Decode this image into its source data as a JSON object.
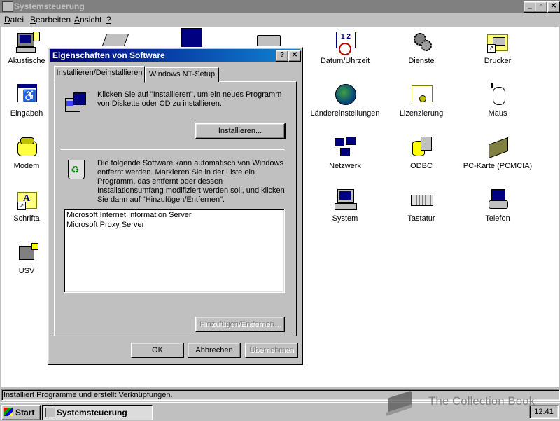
{
  "window": {
    "title": "Systemsteuerung",
    "buttons": {
      "minimize": "_",
      "maximize": "▫",
      "close": "✕"
    }
  },
  "menu": [
    {
      "accel": "D",
      "rest": "atei"
    },
    {
      "accel": "B",
      "rest": "earbeiten"
    },
    {
      "accel": "A",
      "rest": "nsicht"
    },
    {
      "accel": "?",
      "rest": ""
    }
  ],
  "icons": [
    {
      "label": "Akustische"
    },
    {
      "label": "Datum/Uhrzeit"
    },
    {
      "label": "Dienste"
    },
    {
      "label": "Drucker"
    },
    {
      "label": "Eingabeh"
    },
    {
      "label": "Ländereinstellungen"
    },
    {
      "label": "Lizenzierung"
    },
    {
      "label": "Maus"
    },
    {
      "label": "Modem"
    },
    {
      "label": "Netzwerk"
    },
    {
      "label": "ODBC"
    },
    {
      "label": "PC-Karte (PCMCIA)"
    },
    {
      "label": "Schrifta"
    },
    {
      "label": "System"
    },
    {
      "label": "Tastatur"
    },
    {
      "label": "Telefon"
    },
    {
      "label": "USV"
    }
  ],
  "dialog": {
    "title": "Eigenschaften von Software",
    "help_btn": "?",
    "close_btn": "✕",
    "tabs": [
      "Installieren/Deinstallieren",
      "Windows NT-Setup"
    ],
    "install_text": "Klicken Sie auf \"Installieren\", um ein neues Programm von Diskette oder CD zu installieren.",
    "install_btn": "Installieren...",
    "uninstall_text": "Die folgende Software kann automatisch von Windows entfernt werden. Markieren Sie in der Liste ein Programm, das entfernt oder dessen Installationsumfang modifiziert werden soll, und klicken Sie dann auf \"Hinzufügen/Entfernen\".",
    "programs": [
      "Microsoft Internet Information Server",
      "Microsoft Proxy Server"
    ],
    "add_remove_btn": "Hinzufügen/Entfernen...",
    "ok_btn": "OK",
    "cancel_btn": "Abbrechen",
    "apply_btn": "Übernehmen"
  },
  "status": "Installiert Programme und erstellt Verknüpfungen.",
  "taskbar": {
    "start": "Start",
    "task": "Systemsteuerung",
    "clock": "12:41"
  },
  "watermark": "The Collection Book"
}
